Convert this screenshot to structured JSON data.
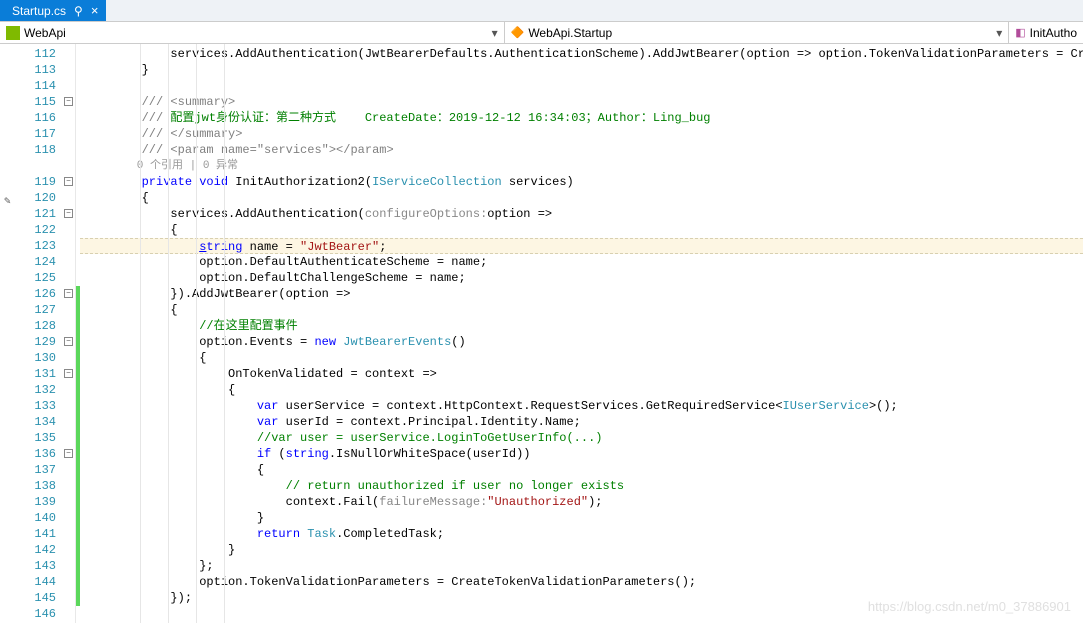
{
  "tab": {
    "title": "Startup.cs",
    "pin_glyph": "⚲",
    "close_glyph": "×"
  },
  "nav": {
    "left": "WebApi",
    "mid": "WebApi.Startup",
    "right": "InitAutho",
    "dd": "▾"
  },
  "lines": {
    "start": 112,
    "numbers": [
      "112",
      "113",
      "114",
      "115",
      "116",
      "117",
      "118",
      "",
      "119",
      "120",
      "121",
      "122",
      "123",
      "124",
      "125",
      "126",
      "127",
      "128",
      "129",
      "130",
      "131",
      "132",
      "133",
      "134",
      "135",
      "136",
      "137",
      "138",
      "139",
      "140",
      "141",
      "142",
      "143",
      "144",
      "145",
      "146"
    ]
  },
  "folds": [
    {
      "ln": 115,
      "g": "−"
    },
    {
      "ln": 119,
      "g": "−"
    },
    {
      "ln": 121,
      "g": "−"
    },
    {
      "ln": 126,
      "g": "−"
    },
    {
      "ln": 129,
      "g": "−"
    },
    {
      "ln": 131,
      "g": "−"
    },
    {
      "ln": 136,
      "g": "−"
    }
  ],
  "change_ranges": [
    [
      126,
      145
    ]
  ],
  "edit_icon_line": 123,
  "code": {
    "l112": "            services.AddAuthentication(JwtBearerDefaults.AuthenticationScheme).AddJwtBearer(option => option.TokenValidationParameters = Crea",
    "l113": "        }",
    "l114": "",
    "l115_a": "        /// ",
    "l115_b": "<summary>",
    "l116_a": "        /// ",
    "l116_b": "配置jwt身份认证：第二种方式    CreateDate：2019-12-12 16:34:03；Author：Ling_bug",
    "l117_a": "        /// ",
    "l117_b": "</summary>",
    "l118_a": "        /// ",
    "l118_b": "<param name=\"",
    "l118_c": "services",
    "l118_d": "\"></param>",
    "lens": "        0 个引用 | 0 异常",
    "l119_a": "        ",
    "l119_b": "private",
    "l119_c": " ",
    "l119_d": "void",
    "l119_e": " InitAuthorization2(",
    "l119_f": "IServiceCollection",
    "l119_g": " services)",
    "l120": "        {",
    "l121_a": "            services.AddAuthentication(",
    "l121_b": "configureOptions:",
    "l121_c": "option =>",
    "l122": "            {",
    "l123_a": "                ",
    "l123_b": "s",
    "l123_b2": "tring",
    "l123_c": " name = ",
    "l123_d": "\"JwtBearer\"",
    "l123_e": ";",
    "l124": "                option.DefaultAuthenticateScheme = name;",
    "l125": "                option.DefaultChallengeScheme = name;",
    "l126": "            }).AddJwtBearer(option =>",
    "l127": "            {",
    "l128_a": "                ",
    "l128_b": "//在这里配置事件",
    "l129_a": "                option.Events = ",
    "l129_b": "new",
    "l129_c": " ",
    "l129_d": "JwtBearerEvents",
    "l129_e": "()",
    "l130": "                {",
    "l131": "                    OnTokenValidated = context =>",
    "l132": "                    {",
    "l133_a": "                        ",
    "l133_b": "var",
    "l133_c": " userService = context.HttpContext.RequestServices.GetRequiredService<",
    "l133_d": "IUserService",
    "l133_e": ">();",
    "l134_a": "                        ",
    "l134_b": "var",
    "l134_c": " userId = context.Principal.Identity.Name;",
    "l135_a": "                        ",
    "l135_b": "//var user = userService.LoginToGetUserInfo(...)",
    "l136_a": "                        ",
    "l136_b": "if",
    "l136_c": " (",
    "l136_d": "string",
    "l136_e": ".IsNullOrWhiteSpace(userId))",
    "l137": "                        {",
    "l138_a": "                            ",
    "l138_b": "// return unauthorized if user no longer exists",
    "l139_a": "                            context.Fail(",
    "l139_b": "failureMessage:",
    "l139_c": "\"Unauthorized\"",
    "l139_d": ");",
    "l140": "                        }",
    "l141_a": "                        ",
    "l141_b": "return",
    "l141_c": " ",
    "l141_d": "Task",
    "l141_e": ".CompletedTask;",
    "l142": "                    }",
    "l143": "                };",
    "l144": "                option.TokenValidationParameters = CreateTokenValidationParameters();",
    "l145": "            });",
    "l146": ""
  },
  "watermark": "https://blog.csdn.net/m0_37886901"
}
